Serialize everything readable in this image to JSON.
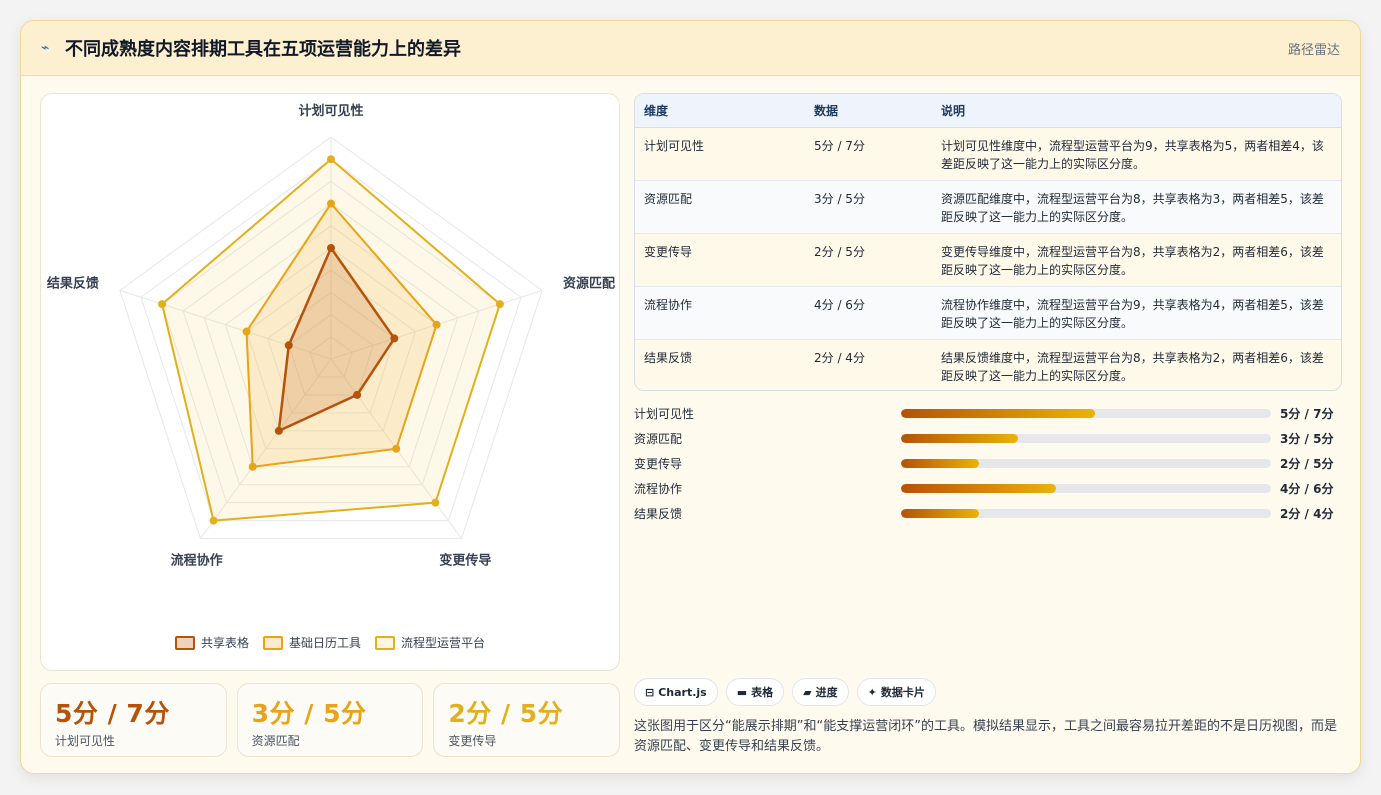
{
  "header": {
    "icon": "lightning-icon",
    "title": "不同成熟度内容排期工具在五项运营能力上的差异",
    "tag": "路径雷达"
  },
  "colors": {
    "series1": "#b45309",
    "series2": "#e8a317",
    "series3": "#e2b01c"
  },
  "chart_data": {
    "type": "radar",
    "axes": [
      "计划可见性",
      "资源匹配",
      "变更传导",
      "流程协作",
      "结果反馈"
    ],
    "rmax": 10,
    "rings": 10,
    "series": [
      {
        "name": "共享表格",
        "values": [
          5,
          3,
          2,
          4,
          2
        ]
      },
      {
        "name": "基础日历工具",
        "values": [
          7,
          5,
          5,
          6,
          4
        ]
      },
      {
        "name": "流程型运营平台",
        "values": [
          9,
          8,
          8,
          9,
          8
        ]
      }
    ],
    "legend_position": "bottom"
  },
  "table": {
    "headers": [
      "维度",
      "数据",
      "说明"
    ],
    "rows": [
      {
        "dim": "计划可见性",
        "val": "5分 / 7分",
        "desc": "计划可见性维度中，流程型运营平台为9，共享表格为5，两者相差4，该差距反映了这一能力上的实际区分度。"
      },
      {
        "dim": "资源匹配",
        "val": "3分 / 5分",
        "desc": "资源匹配维度中，流程型运营平台为8，共享表格为3，两者相差5，该差距反映了这一能力上的实际区分度。"
      },
      {
        "dim": "变更传导",
        "val": "2分 / 5分",
        "desc": "变更传导维度中，流程型运营平台为8，共享表格为2，两者相差6，该差距反映了这一能力上的实际区分度。"
      },
      {
        "dim": "流程协作",
        "val": "4分 / 6分",
        "desc": "流程协作维度中，流程型运营平台为9，共享表格为4，两者相差5，该差距反映了这一能力上的实际区分度。"
      },
      {
        "dim": "结果反馈",
        "val": "2分 / 4分",
        "desc": "结果反馈维度中，流程型运营平台为8，共享表格为2，两者相差6，该差距反映了这一能力上的实际区分度。"
      }
    ]
  },
  "progress": [
    {
      "label": "计划可见性",
      "value": "5分 / 7分",
      "ratio": 0.525
    },
    {
      "label": "资源匹配",
      "value": "3分 / 5分",
      "ratio": 0.315
    },
    {
      "label": "变更传导",
      "value": "2分 / 5分",
      "ratio": 0.21
    },
    {
      "label": "流程协作",
      "value": "4分 / 6分",
      "ratio": 0.42
    },
    {
      "label": "结果反馈",
      "value": "2分 / 4分",
      "ratio": 0.21
    }
  ],
  "stats": [
    {
      "value": "5分 / 7分",
      "label": "计划可见性",
      "color": "#b45309"
    },
    {
      "value": "3分 / 5分",
      "label": "资源匹配",
      "color": "#e8a317"
    },
    {
      "value": "2分 / 5分",
      "label": "变更传导",
      "color": "#e2b01c"
    }
  ],
  "chips": [
    {
      "icon": "chart-icon",
      "glyph": "⊟",
      "label": "Chart.js"
    },
    {
      "icon": "table-icon",
      "glyph": "▬",
      "label": "表格"
    },
    {
      "icon": "progress-icon",
      "glyph": "▰",
      "label": "进度"
    },
    {
      "icon": "sparkle-icon",
      "glyph": "✦",
      "label": "数据卡片"
    }
  ],
  "summary": "这张图用于区分“能展示排期”和“能支撑运营闭环”的工具。模拟结果显示，工具之间最容易拉开差距的不是日历视图，而是资源匹配、变更传导和结果反馈。"
}
